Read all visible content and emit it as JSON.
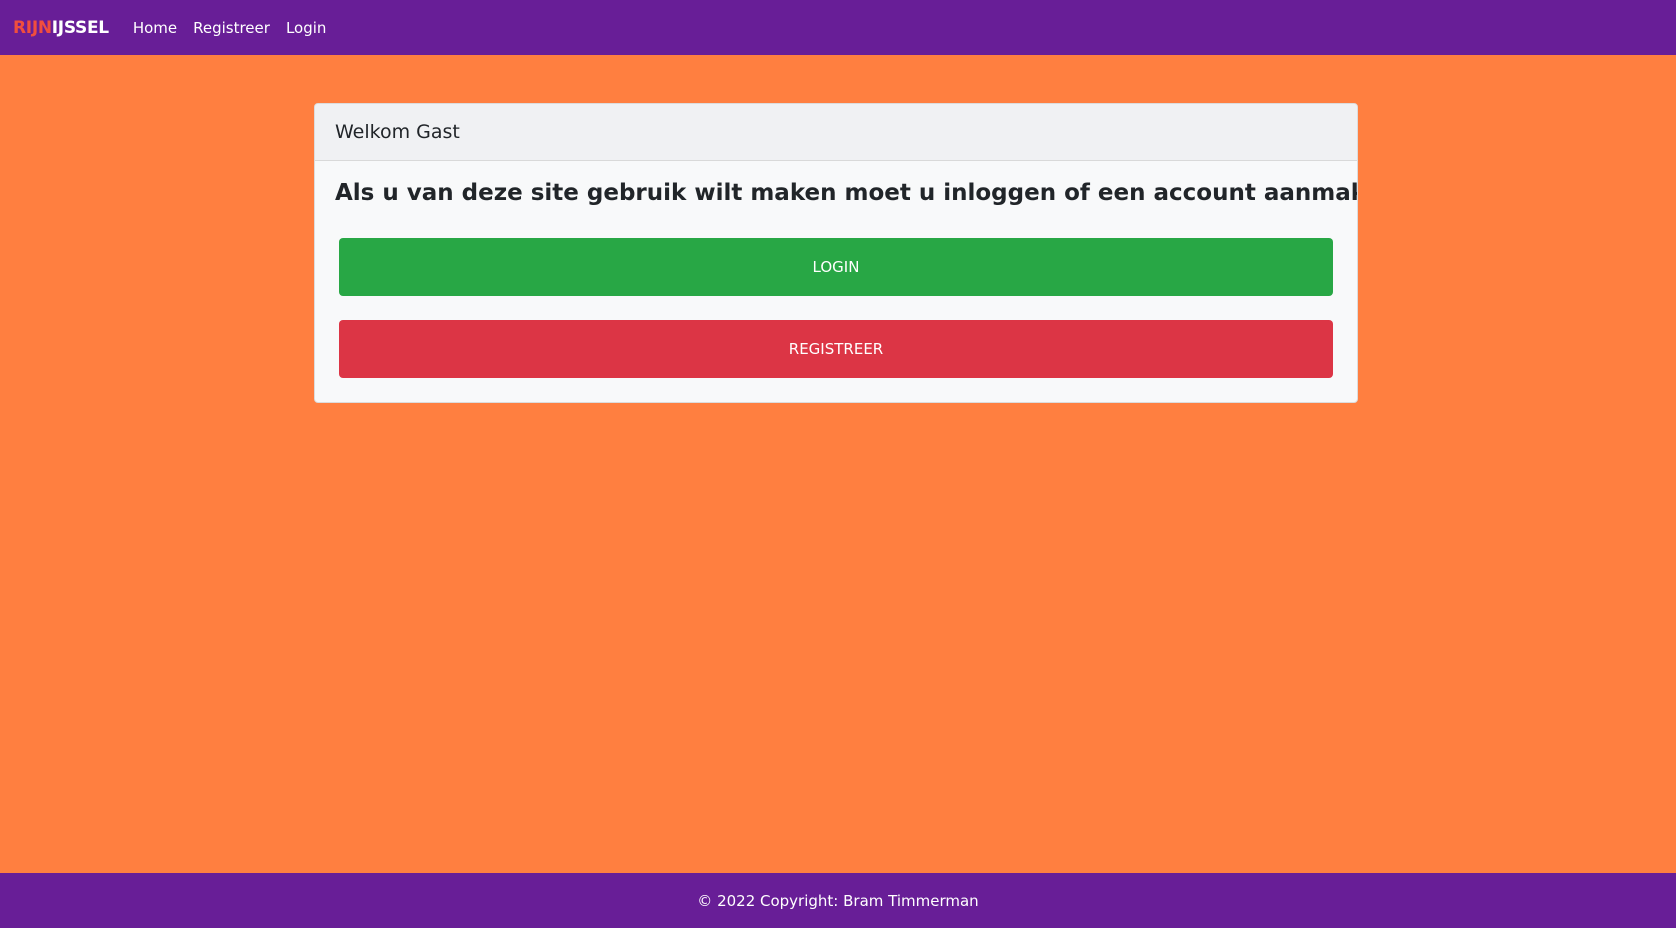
{
  "navbar": {
    "brand_part1": "RIJN",
    "brand_part2": "IJSSEL",
    "links": [
      "Home",
      "Registreer",
      "Login"
    ]
  },
  "card": {
    "header": "Welkom Gast",
    "title": "Als u van deze site gebruik wilt maken moet u inloggen of een account aanmaken",
    "login_button": "LOGIN",
    "register_button": "REGISTREER"
  },
  "footer": {
    "text": "© 2022 Copyright: Bram Timmerman"
  },
  "colors": {
    "background": "#ff7f40",
    "navbar": "#681e97",
    "brand_accent": "#f04e3e",
    "login": "#28a745",
    "register": "#dc3545"
  }
}
